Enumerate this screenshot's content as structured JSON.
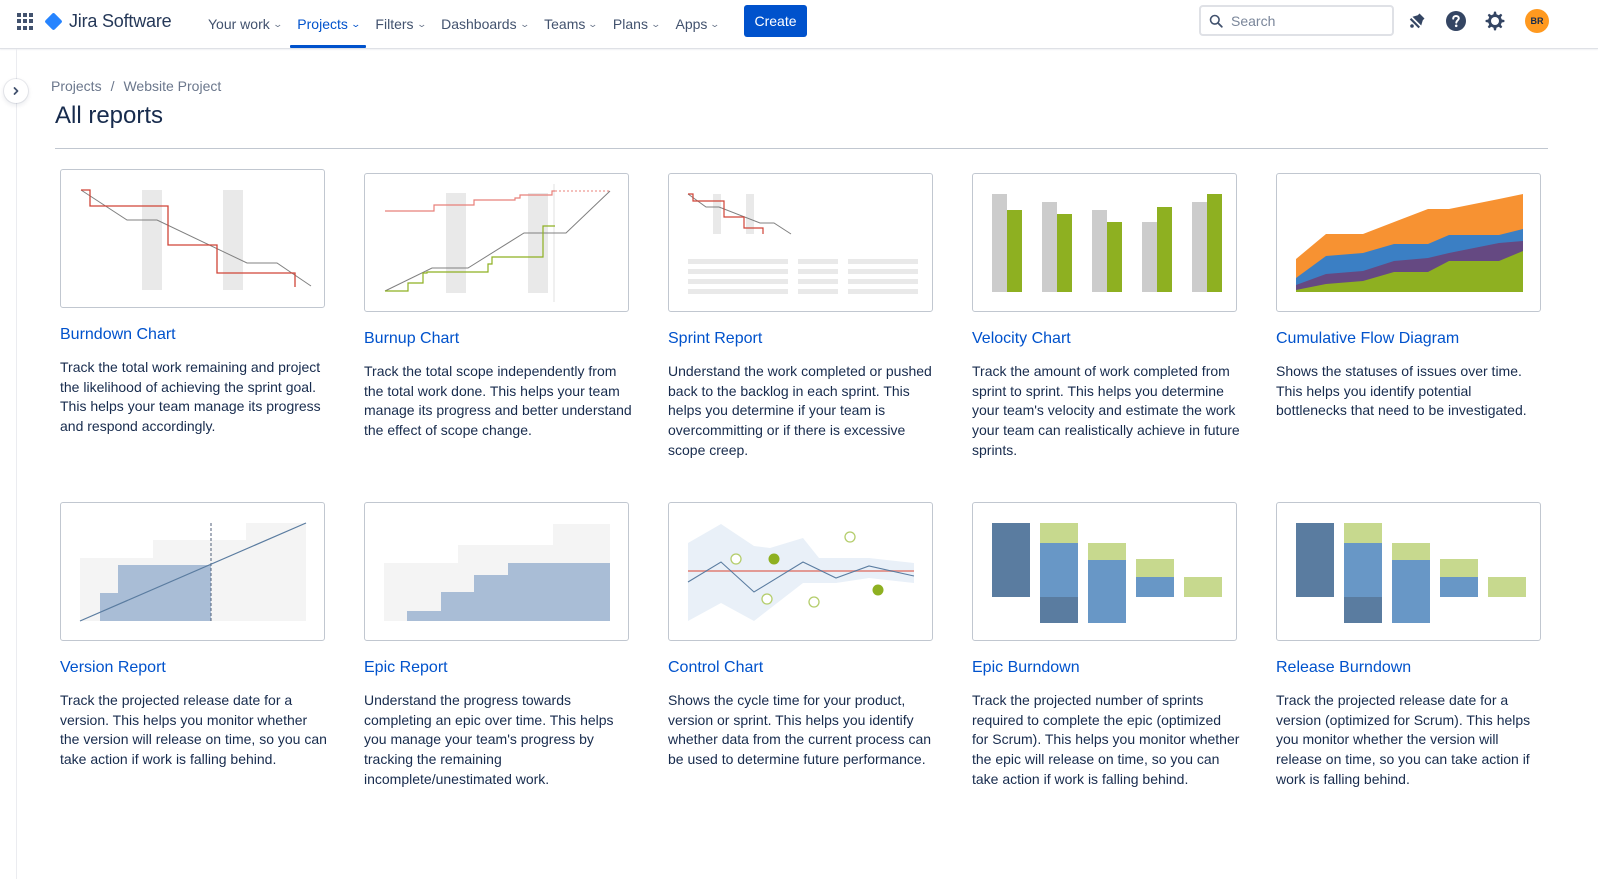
{
  "topnav": {
    "app_switcher_icon": "grid-icon",
    "product_name": "Jira Software",
    "items": [
      {
        "label": "Your work",
        "active": false
      },
      {
        "label": "Projects",
        "active": true
      },
      {
        "label": "Filters",
        "active": false
      },
      {
        "label": "Dashboards",
        "active": false
      },
      {
        "label": "Teams",
        "active": false
      },
      {
        "label": "Plans",
        "active": false
      },
      {
        "label": "Apps",
        "active": false
      }
    ],
    "create_label": "Create",
    "search_placeholder": "Search",
    "notifications_icon": "bell-icon",
    "help_icon": "help-icon",
    "settings_icon": "gear-icon",
    "avatar_initials": "BR",
    "colors": {
      "brand": "#0052cc",
      "logo": "#2684ff",
      "avatar": "#ff991f"
    }
  },
  "breadcrumb": [
    {
      "label": "Projects"
    },
    {
      "label": "Website Project"
    }
  ],
  "breadcrumb_separator": "/",
  "page_title": "All reports",
  "reports": [
    {
      "title": "Burndown Chart",
      "thumbnail": "burndown",
      "description": "Track the total work remaining and project the likelihood of achieving the sprint goal. This helps your team manage its progress and respond accordingly."
    },
    {
      "title": "Burnup Chart",
      "thumbnail": "burnup",
      "description": "Track the total scope independently from the total work done. This helps your team manage its progress and better understand the effect of scope change."
    },
    {
      "title": "Sprint Report",
      "thumbnail": "sprint-report",
      "description": "Understand the work completed or pushed back to the backlog in each sprint. This helps you determine if your team is overcommitting or if there is excessive scope creep."
    },
    {
      "title": "Velocity Chart",
      "thumbnail": "velocity",
      "description": "Track the amount of work completed from sprint to sprint. This helps you determine your team's velocity and estimate the work your team can realistically achieve in future sprints."
    },
    {
      "title": "Cumulative Flow Diagram",
      "thumbnail": "cumulative-flow",
      "description": "Shows the statuses of issues over time. This helps you identify potential bottlenecks that need to be investigated."
    },
    {
      "title": "Version Report",
      "thumbnail": "version-report",
      "description": "Track the projected release date for a version. This helps you monitor whether the version will release on time, so you can take action if work is falling behind."
    },
    {
      "title": "Epic Report",
      "thumbnail": "epic-report",
      "description": "Understand the progress towards completing an epic over time. This helps you manage your team's progress by tracking the remaining incomplete/unestimated work."
    },
    {
      "title": "Control Chart",
      "thumbnail": "control-chart",
      "description": "Shows the cycle time for your product, version or sprint. This helps you identify whether data from the current process can be used to determine future performance."
    },
    {
      "title": "Epic Burndown",
      "thumbnail": "epic-burndown",
      "description": "Track the projected number of sprints required to complete the epic (optimized for Scrum). This helps you monitor whether the epic will release on time, so you can take action if work is falling behind."
    },
    {
      "title": "Release Burndown",
      "thumbnail": "release-burndown",
      "description": "Track the projected release date for a version (optimized for Scrum). This helps you monitor whether the version will release on time, so you can take action if work is falling behind."
    }
  ],
  "thumbnail_colors": {
    "red": "#d04437",
    "grey_line": "#808080",
    "weekend": "#e9e9e9",
    "green": "#8eb021",
    "light_green": "#c7d98e",
    "dark_blue": "#5a7ca0",
    "mid_blue": "#6897c6",
    "pale_blue": "#a9bdd6",
    "orange": "#f79232",
    "blue": "#3b7fc4",
    "purple": "#654982",
    "placeholder": "#f4f4f4"
  }
}
